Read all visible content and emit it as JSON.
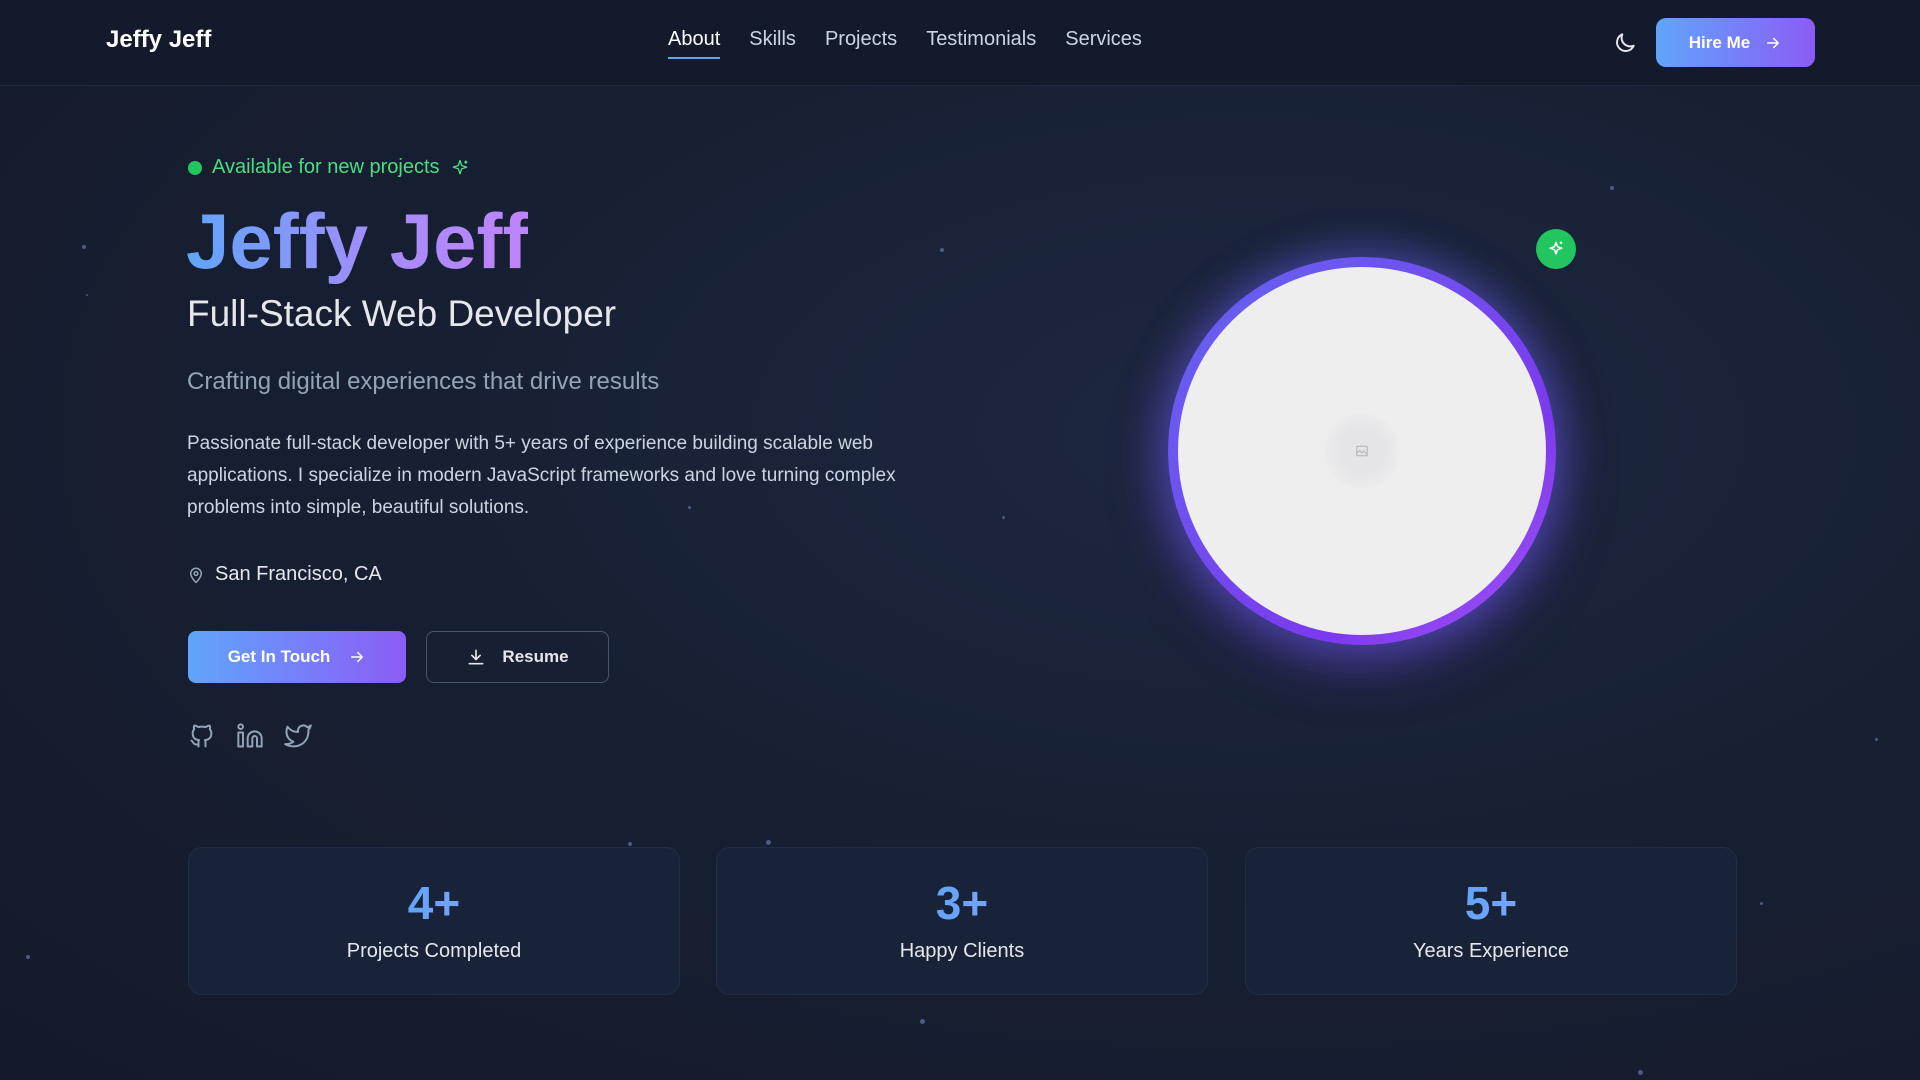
{
  "brand": {
    "name": "Jeffy Jeff"
  },
  "nav": {
    "links": [
      {
        "label": "About",
        "active": true
      },
      {
        "label": "Skills",
        "active": false
      },
      {
        "label": "Projects",
        "active": false
      },
      {
        "label": "Testimonials",
        "active": false
      },
      {
        "label": "Services",
        "active": false
      }
    ],
    "theme_toggle_icon": "moon-icon",
    "hire_button": "Hire Me"
  },
  "hero": {
    "availability": "Available for new projects",
    "name": "Jeffy Jeff",
    "role": "Full-Stack Web Developer",
    "tagline": "Crafting digital experiences that drive results",
    "bio": "Passionate full-stack developer with 5+ years of experience building scalable web applications. I specialize in modern JavaScript frameworks and love turning complex problems into simple, beautiful solutions.",
    "location": "San Francisco, CA",
    "primary_button": "Get In Touch",
    "secondary_button": "Resume",
    "socials": [
      "github-icon",
      "linkedin-icon",
      "twitter-icon"
    ]
  },
  "stats": [
    {
      "value": "4+",
      "label": "Projects Completed"
    },
    {
      "value": "3+",
      "label": "Happy Clients"
    },
    {
      "value": "5+",
      "label": "Years Experience"
    }
  ],
  "colors": {
    "accent_blue": "#60a5fa",
    "accent_purple": "#8b5cf6",
    "status_green": "#22c55e",
    "background": "#172033"
  }
}
